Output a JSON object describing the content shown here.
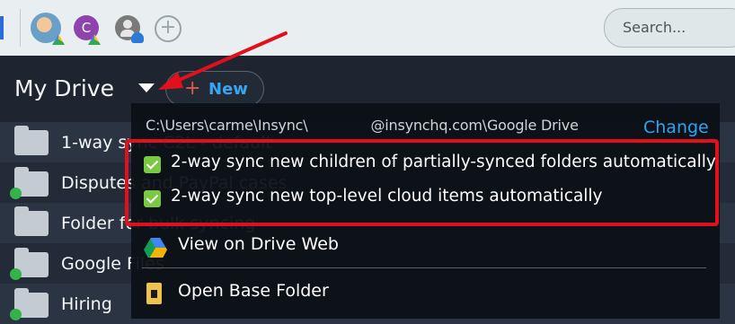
{
  "topbar": {
    "accounts": [
      {
        "name": "avatar-photo"
      },
      {
        "initial": "C"
      },
      {
        "name": "avatar-generic"
      }
    ],
    "add_account_symbol": "+",
    "search_placeholder": "Search..."
  },
  "header": {
    "title": "My Drive",
    "new_label": "New",
    "new_symbol": "+"
  },
  "files": [
    {
      "name": "1-way sync C2L - default",
      "synced": false
    },
    {
      "name": "Disputes and PayPal cases",
      "synced": true
    },
    {
      "name": "Folder for bulk syncing",
      "synced": false
    },
    {
      "name": "Google Files",
      "synced": true
    },
    {
      "name": "Hiring",
      "synced": true
    }
  ],
  "dropdown": {
    "path_prefix": "C:\\Users\\carme\\Insync\\",
    "path_suffix": "@insynchq.com\\Google Drive",
    "change_label": "Change",
    "options": [
      {
        "label": "2-way sync new children of partially-synced folders automatically",
        "checked": true
      },
      {
        "label": "2-way sync new top-level cloud items automatically",
        "checked": true
      }
    ],
    "menu": [
      {
        "label": "View on Drive Web",
        "icon": "google-drive-icon"
      },
      {
        "label": "Open Base Folder",
        "icon": "folder-icon"
      }
    ]
  },
  "colors": {
    "accent_blue": "#2fa3ef",
    "highlight_red": "#e20f1c",
    "checkbox_green": "#7ac943"
  }
}
